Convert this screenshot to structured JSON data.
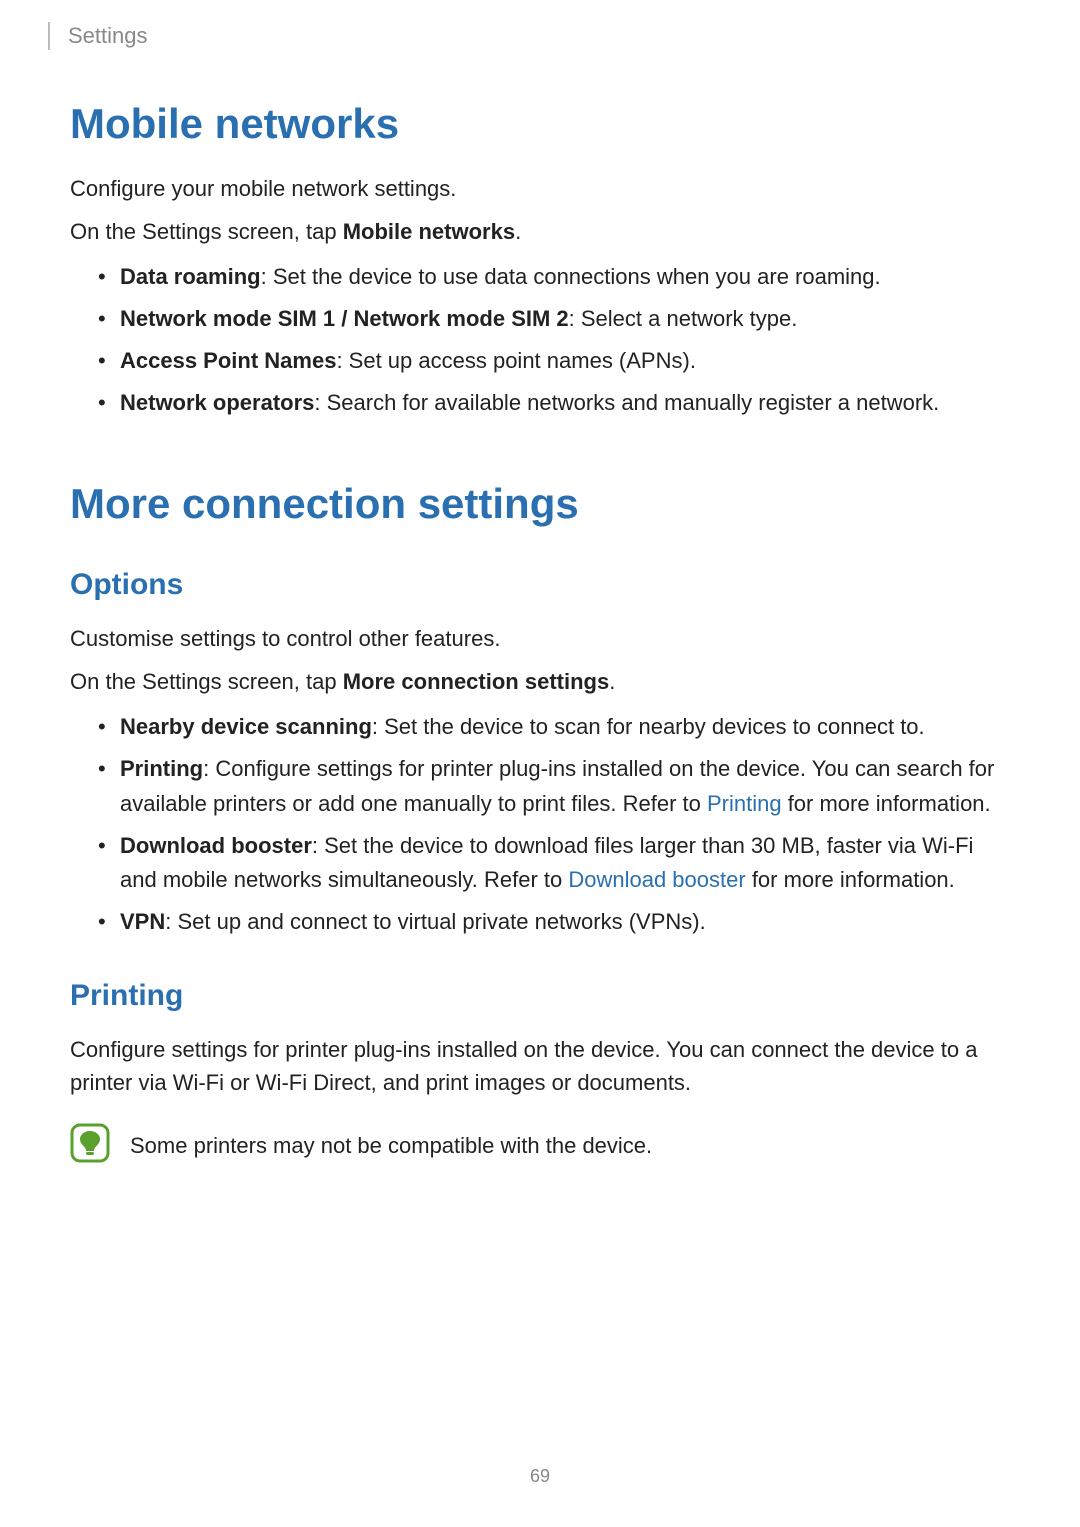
{
  "header": {
    "section": "Settings"
  },
  "mobile_networks": {
    "title": "Mobile networks",
    "intro": "Configure your mobile network settings.",
    "instruction_prefix": "On the Settings screen, tap ",
    "instruction_bold": "Mobile networks",
    "instruction_suffix": ".",
    "items": [
      {
        "bold": "Data roaming",
        "desc": ": Set the device to use data connections when you are roaming."
      },
      {
        "bold": "Network mode SIM 1 / Network mode SIM 2",
        "desc": ": Select a network type."
      },
      {
        "bold": "Access Point Names",
        "desc": ": Set up access point names (APNs)."
      },
      {
        "bold": "Network operators",
        "desc": ": Search for available networks and manually register a network."
      }
    ]
  },
  "more_connection": {
    "title": "More connection settings",
    "options_heading": "Options",
    "intro": "Customise settings to control other features.",
    "instruction_prefix": "On the Settings screen, tap ",
    "instruction_bold": "More connection settings",
    "instruction_suffix": ".",
    "items": {
      "nearby": {
        "bold": "Nearby device scanning",
        "desc": ": Set the device to scan for nearby devices to connect to."
      },
      "printing": {
        "bold": "Printing",
        "pre": ": Configure settings for printer plug-ins installed on the device. You can search for available printers or add one manually to print files. Refer to ",
        "link": "Printing",
        "post": " for more information."
      },
      "download": {
        "bold": "Download booster",
        "pre": ": Set the device to download files larger than 30 MB, faster via Wi-Fi and mobile networks simultaneously. Refer to ",
        "link": "Download booster",
        "post": " for more information."
      },
      "vpn": {
        "bold": "VPN",
        "desc": ": Set up and connect to virtual private networks (VPNs)."
      }
    },
    "printing_heading": "Printing",
    "printing_body": "Configure settings for printer plug-ins installed on the device. You can connect the device to a printer via Wi-Fi or Wi-Fi Direct, and print images or documents.",
    "printing_note": "Some printers may not be compatible with the device."
  },
  "page_number": "69"
}
